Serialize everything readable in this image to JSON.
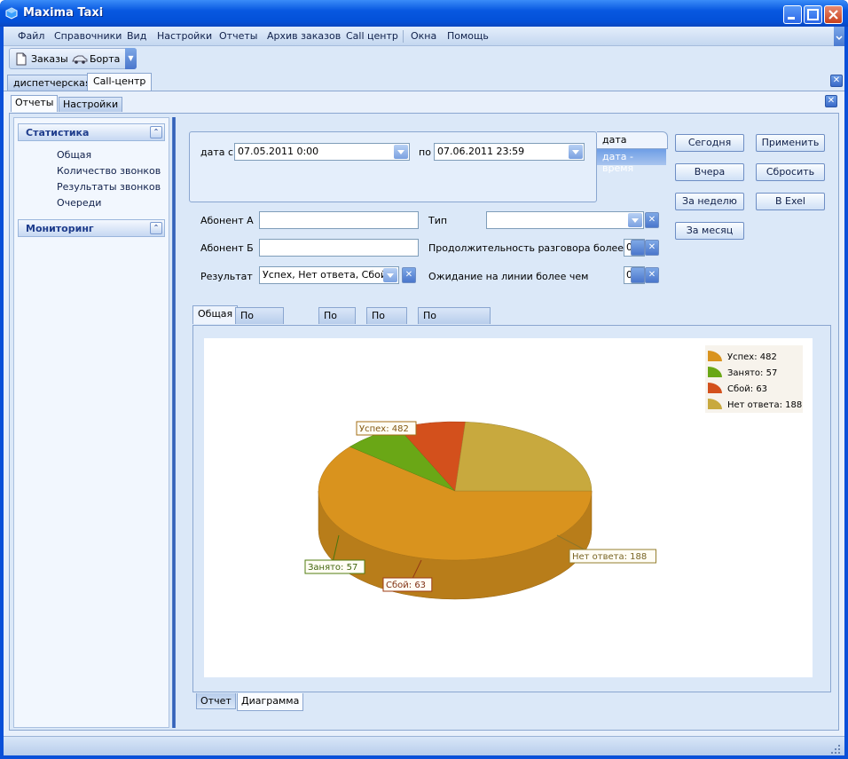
{
  "window": {
    "title": "Maxima Taxi"
  },
  "menu": [
    "Файл",
    "Справочники",
    "Вид",
    "Настройки",
    "Отчеты",
    "Архив заказов",
    "Call центр",
    "Окна",
    "Помощь"
  ],
  "toolbar": {
    "orders": "Заказы",
    "boards": "Борта"
  },
  "top_tabs": [
    "диспетчерская",
    "Call-центр"
  ],
  "sub_tabs": [
    "Отчеты",
    "Настройки"
  ],
  "nav": {
    "stats_title": "Статистика",
    "stats_items": [
      "Общая",
      "Количество звонков",
      "Результаты звонков",
      "Очереди"
    ],
    "monitoring_title": "Мониторинг"
  },
  "filters": {
    "date_from_label": "дата с",
    "date_from": "07.05.2011 0:00",
    "date_to_label": "по",
    "date_to": "07.06.2011 23:59",
    "mode_tabs": [
      "дата",
      "дата - время"
    ],
    "abonent_a_label": "Абонент А",
    "abonent_b_label": "Абонент Б",
    "result_label": "Результат",
    "result_value": "Успех, Нет ответа, Сбой…",
    "type_label": "Тип",
    "duration_label": "Продолжительность разговора более чем",
    "duration_value": "0",
    "wait_label": "Ожидание на линии более чем",
    "wait_value": "0"
  },
  "buttons": {
    "today": "Сегодня",
    "yesterday": "Вчера",
    "week": "За неделю",
    "month": "За месяц",
    "apply": "Применить",
    "reset": "Сбросить",
    "excel": "В Exel"
  },
  "chart_tabs": [
    "Общая",
    "По дням недели",
    "По дням",
    "По часам",
    "По операторам"
  ],
  "bottom_tabs": [
    "Отчет",
    "Диаграмма"
  ],
  "chart_data": {
    "type": "pie",
    "title": "",
    "slices": [
      {
        "name": "Успех",
        "value": 482,
        "label": "Успех: 482",
        "color": "#d9931e"
      },
      {
        "name": "Занято",
        "value": 57,
        "label": "Занято: 57",
        "color": "#6aa716"
      },
      {
        "name": "Сбой",
        "value": 63,
        "label": "Сбой: 63",
        "color": "#d3501c"
      },
      {
        "name": "Нет ответа",
        "value": 188,
        "label": "Нет ответа: 188",
        "color": "#c8a93e"
      }
    ],
    "legend_position": "top-right"
  }
}
